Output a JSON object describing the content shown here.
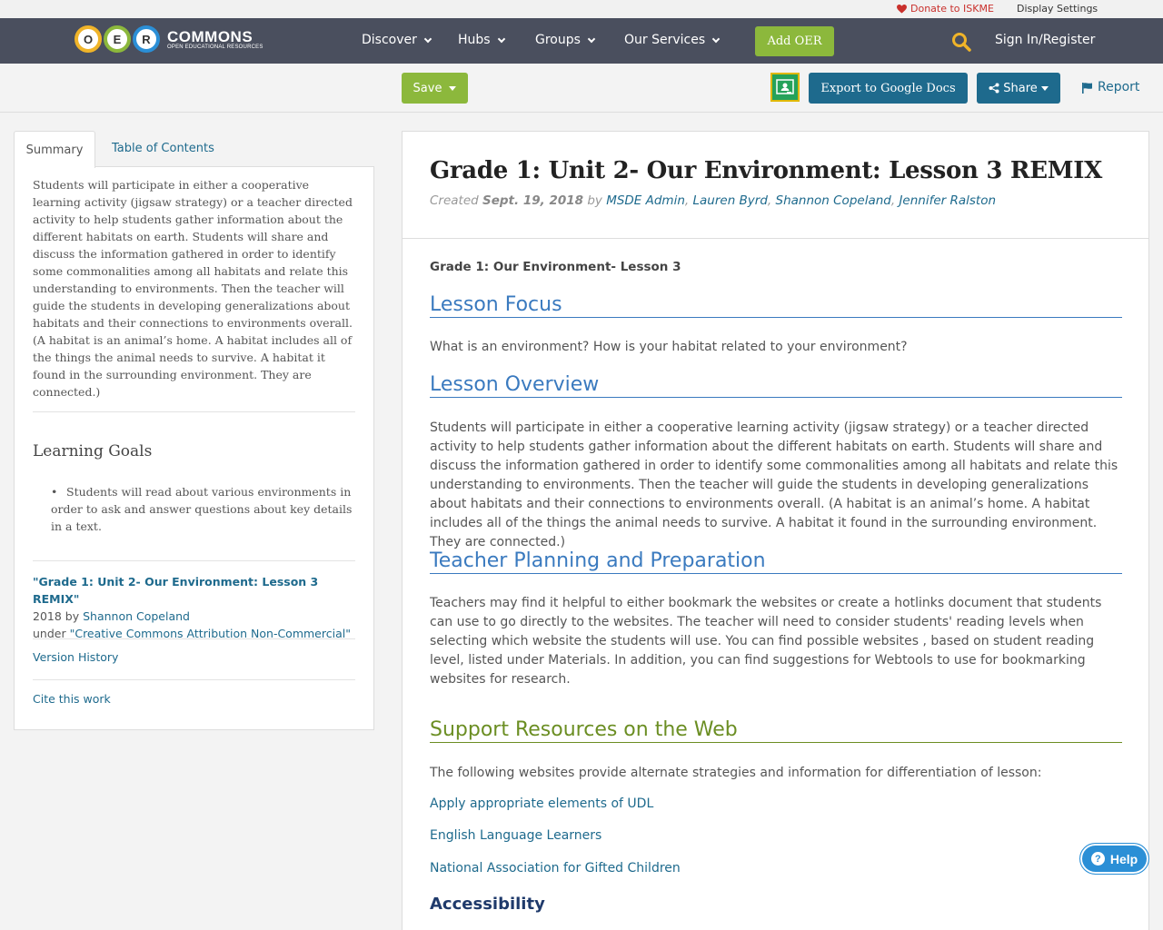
{
  "utility": {
    "donate": "Donate to ISKME",
    "display_settings": "Display Settings"
  },
  "logo": {
    "letters": [
      "O",
      "E",
      "R"
    ],
    "name": "COMMONS",
    "tagline": "OPEN EDUCATIONAL RESOURCES"
  },
  "nav": {
    "discover": "Discover",
    "hubs": "Hubs",
    "groups": "Groups",
    "services": "Our Services",
    "add_oer": "Add OER",
    "signin": "Sign In/Register"
  },
  "toolbar": {
    "save": "Save",
    "export": "Export to Google Docs",
    "share": "Share",
    "report": "Report"
  },
  "sidebar": {
    "tabs": {
      "summary": "Summary",
      "toc": "Table of Contents"
    },
    "summary": "Students will participate in either a cooperative learning activity (jigsaw strategy) or a teacher directed activity to help students gather information about the different habitats on earth. Students will share and discuss the information gathered in order to identify some commonalities among all habitats and relate this understanding to environments. Then the teacher will guide the students in developing generalizations about habitats and their connections to environments overall. (A habitat is an animal’s home. A habitat includes all of the things the animal needs to survive. A habitat it found in the surrounding environment. They are connected.)",
    "learning_goals_title": "Learning Goals",
    "learning_goals": [
      "Students will read about various environments in order to ask and answer questions about key details in a text."
    ],
    "attribution": {
      "title": "\"Grade 1: Unit 2- Our Environment: Lesson 3 REMIX\"",
      "year_by": "2018 by ",
      "author": "Shannon Copeland",
      "under": "under ",
      "license": "\"Creative Commons Attribution Non-Commercial\""
    },
    "version_history": "Version History",
    "cite": "Cite this work"
  },
  "main": {
    "title": "Grade 1: Unit 2- Our Environment: Lesson 3 REMIX",
    "meta": {
      "created": "Created ",
      "date": "Sept. 19, 2018",
      "by": " by ",
      "authors": [
        "MSDE Admin",
        "Lauren Byrd",
        "Shannon Copeland",
        "Jennifer Ralston"
      ],
      "sep": ", "
    },
    "subtitle": "Grade 1: Our Environment- Lesson 3",
    "focus_h": "Lesson Focus",
    "focus_p": "What is an environment? How is your habitat related to your environment?",
    "overview_h": "Lesson Overview",
    "overview_p": "Students will participate in either a cooperative learning activity (jigsaw strategy) or a teacher directed activity to help students gather information about the different habitats on earth. Students will share and discuss the information gathered in order to identify some commonalities among all habitats and relate this understanding to environments. Then the teacher will guide the students in developing generalizations about habitats and their connections to environments overall. (A habitat is an animal’s home. A habitat includes all of the things the animal needs to survive. A habitat it found in the surrounding environment. They are connected.)",
    "planning_h": "Teacher Planning and Preparation",
    "planning_p": "Teachers may find it helpful to either bookmark the websites or create a hotlinks document that students can use to go directly to the websites. The teacher will need to consider students' reading levels when selecting which website the students will use. You can find possible websites , based on student reading level, listed under Materials. In addition, you can find suggestions for Webtools to use for bookmarking websites for research.",
    "support_h": "Support Resources on the Web",
    "support_p": "The following websites provide alternate strategies and information for differentiation of lesson:",
    "links": [
      "Apply appropriate elements of UDL",
      "English Language Learners",
      "National Association for Gifted Children"
    ],
    "accessibility_h": "Accessibility"
  },
  "help": "Help",
  "colors": {
    "navbar": "#4a4f5e",
    "green": "#8cb83c",
    "blue": "#1e6a8d",
    "heading_blue": "#3a7abf",
    "heading_green": "#6b8e23"
  }
}
